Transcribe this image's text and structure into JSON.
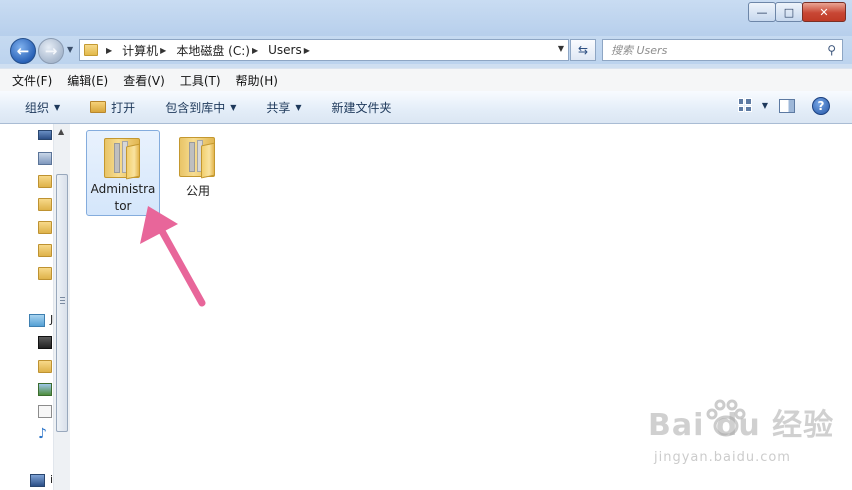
{
  "window": {
    "controls": [
      "minimize",
      "maximize",
      "close"
    ]
  },
  "navigation": {
    "back_icon": "back-arrow-icon",
    "forward_icon": "forward-arrow-icon",
    "breadcrumb": [
      "计算机",
      "本地磁盘 (C:)",
      "Users"
    ],
    "search_placeholder": "搜索 Users"
  },
  "menubar": {
    "items": [
      "文件(F)",
      "编辑(E)",
      "查看(V)",
      "工具(T)",
      "帮助(H)"
    ]
  },
  "toolbar": {
    "organize": "组织",
    "open": "打开",
    "include_in_library": "包含到库中",
    "share": "共享",
    "new_folder": "新建文件夹"
  },
  "navpane": {
    "label_fragments": [
      "J",
      "i"
    ]
  },
  "files": [
    {
      "name": "Administrator",
      "label_line1": "Administra",
      "label_line2": "tor",
      "selected": true
    },
    {
      "name": "公用",
      "label_line1": "公用",
      "label_line2": "",
      "selected": false
    }
  ],
  "watermark": {
    "brand": "Bai du 经验",
    "site": "jingyan.baidu.com"
  },
  "colors": {
    "annotation_arrow": "#e8669a",
    "selection_border": "#84acdd",
    "folder_yellow": "#f2cf6d"
  }
}
